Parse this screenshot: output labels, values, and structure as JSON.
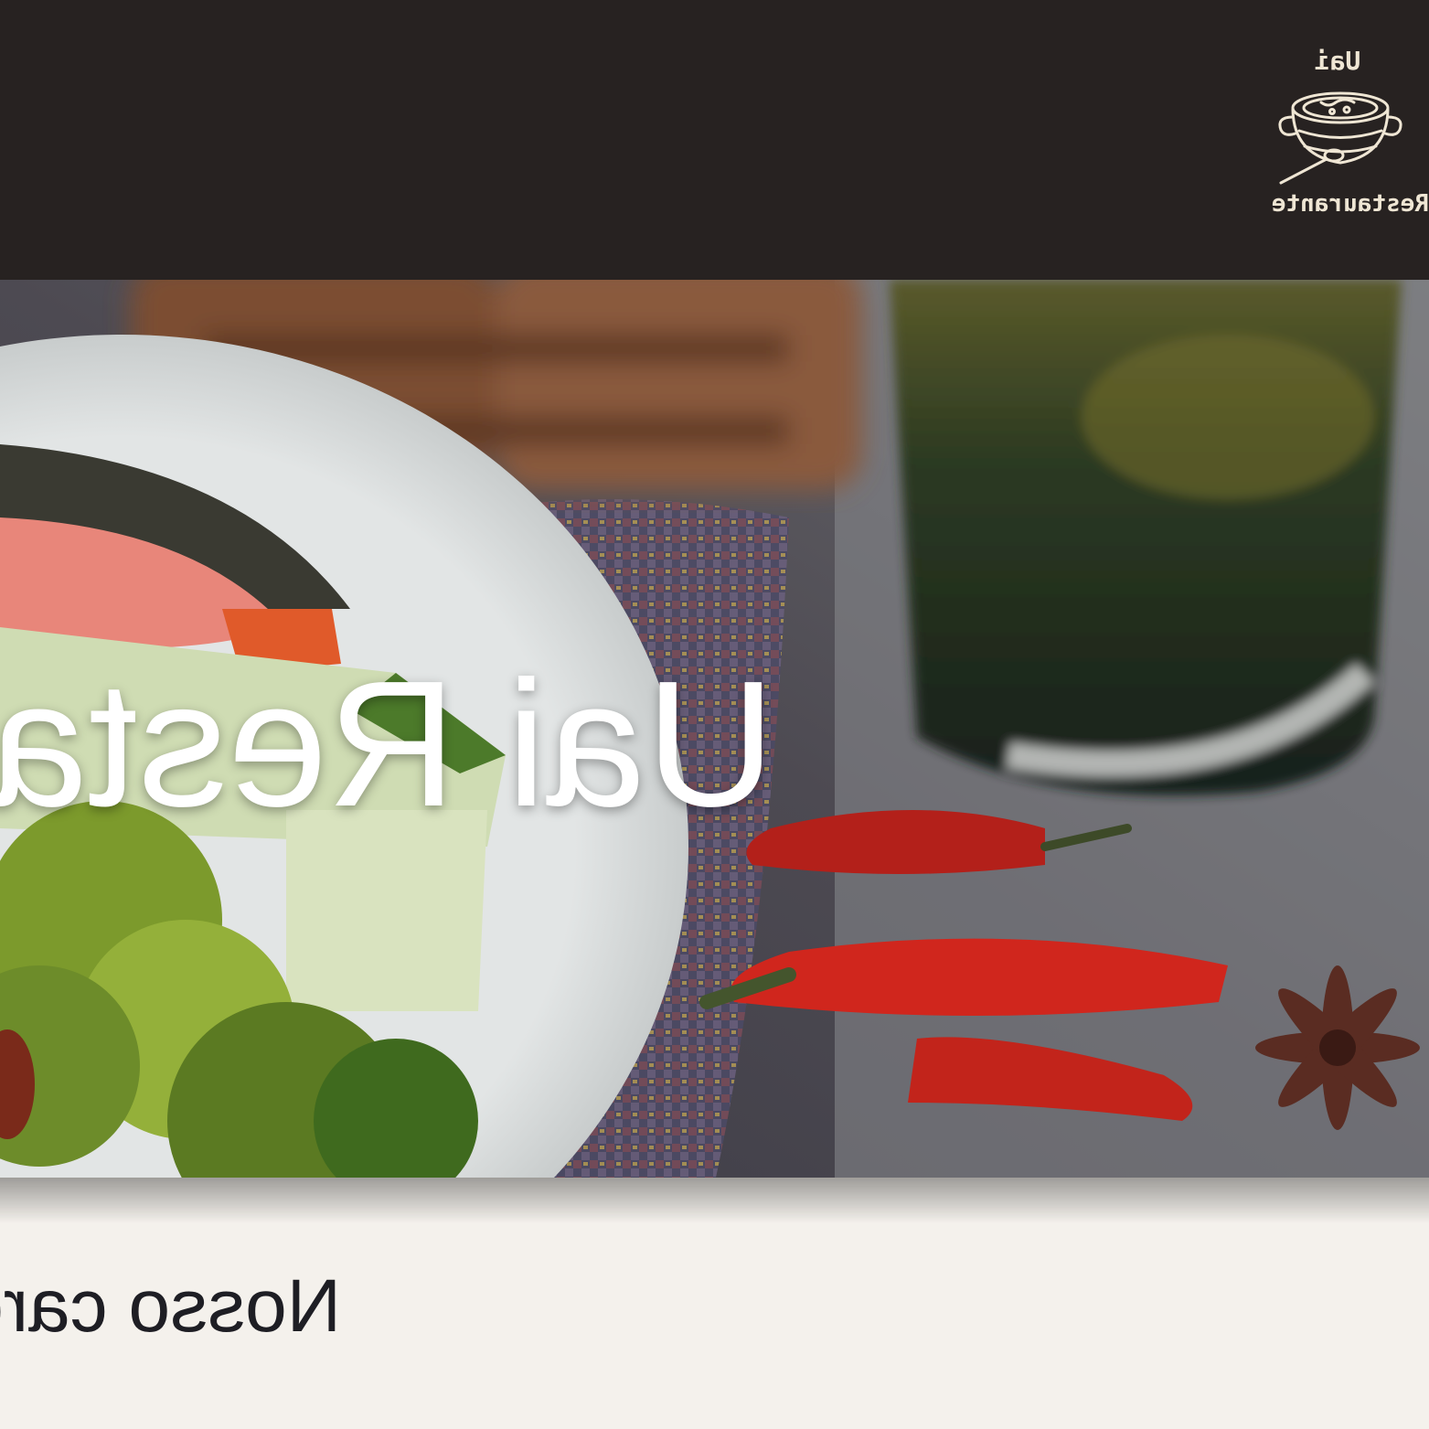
{
  "header": {
    "logo": {
      "top_text": "Uai",
      "bottom_text": "Restaurante",
      "icon": "soup-pot-icon"
    }
  },
  "hero": {
    "title": "Uai Restaurante",
    "background": "food-photo"
  },
  "section": {
    "heading": "Nosso cardápio"
  },
  "colors": {
    "header_bg": "#272221",
    "logo_color": "#efe6d4",
    "page_bg": "#f4f1ec",
    "heading_color": "#1e1e24",
    "hero_text": "#ffffff"
  }
}
